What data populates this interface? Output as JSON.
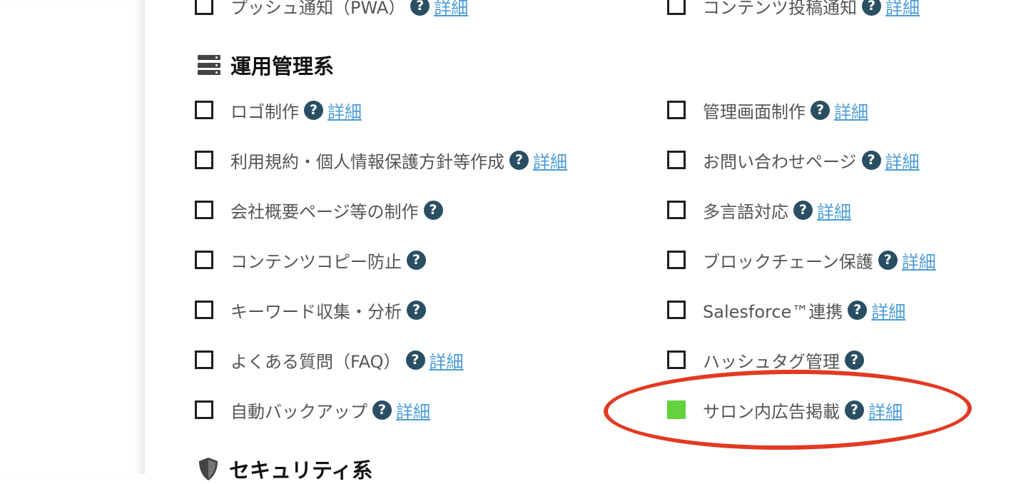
{
  "sections": {
    "operations": {
      "title": "運用管理系",
      "icon": "server-icon"
    },
    "security": {
      "title": "セキュリティ系",
      "icon": "shield-icon"
    }
  },
  "detail_label": "詳細",
  "top_row": {
    "left": {
      "label": "プッシュ通知（PWA）",
      "checked": false,
      "has_detail": true
    },
    "right": {
      "label": "コンテンツ投稿通知",
      "checked": false,
      "has_detail": true
    }
  },
  "operations_items": {
    "left": [
      {
        "label": "ロゴ制作",
        "checked": false,
        "has_detail": true
      },
      {
        "label": "利用規約・個人情報保護方針等作成",
        "checked": false,
        "has_detail": true
      },
      {
        "label": "会社概要ページ等の制作",
        "checked": false,
        "has_detail": false
      },
      {
        "label": "コンテンツコピー防止",
        "checked": false,
        "has_detail": false
      },
      {
        "label": "キーワード収集・分析",
        "checked": false,
        "has_detail": false
      },
      {
        "label": "よくある質問（FAQ）",
        "checked": false,
        "has_detail": true
      },
      {
        "label": "自動バックアップ",
        "checked": false,
        "has_detail": true
      }
    ],
    "right": [
      {
        "label": "管理画面制作",
        "checked": false,
        "has_detail": true
      },
      {
        "label": "お問い合わせページ",
        "checked": false,
        "has_detail": true
      },
      {
        "label": "多言語対応",
        "checked": false,
        "has_detail": true
      },
      {
        "label": "ブロックチェーン保護",
        "checked": false,
        "has_detail": true
      },
      {
        "label": "Salesforce™連携",
        "checked": false,
        "has_detail": true
      },
      {
        "label": "ハッシュタグ管理",
        "checked": false,
        "has_detail": false
      },
      {
        "label": "サロン内広告掲載",
        "checked": true,
        "has_detail": true
      }
    ]
  },
  "colors": {
    "checked": "#64d23c",
    "help_icon": "#2a4f63",
    "link": "#4a9bd6",
    "highlight": "#e23a22"
  }
}
